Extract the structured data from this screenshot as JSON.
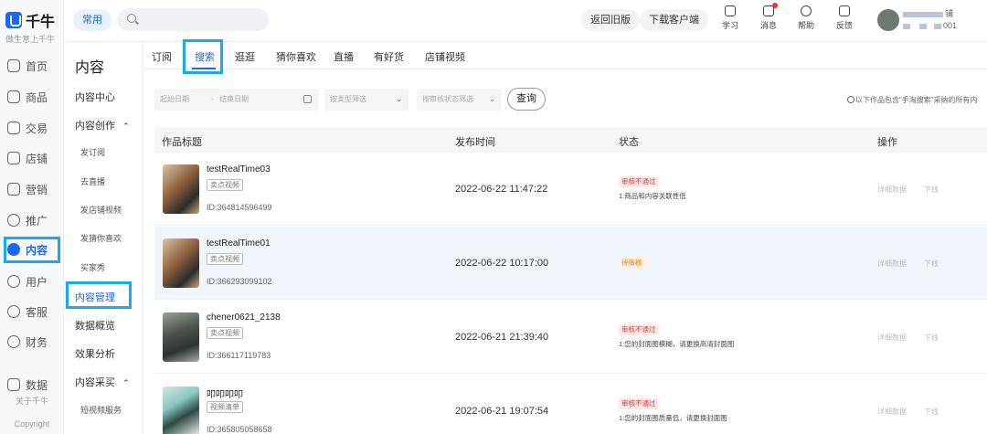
{
  "brand": {
    "name": "千牛",
    "slogan": "做生意上千牛"
  },
  "rail": {
    "items": [
      "首页",
      "商品",
      "交易",
      "店铺",
      "营销",
      "推广",
      "内容",
      "用户",
      "客服",
      "财务",
      "数据"
    ],
    "footer1": "关于千牛",
    "footer2": "Copyright"
  },
  "topbar": {
    "common": "常用",
    "old_version": "返回旧版",
    "download": "下载客户端",
    "tools": [
      "学习",
      "消息",
      "帮助",
      "反馈"
    ],
    "shop_suffix": "铺",
    "account_suffix": "001"
  },
  "nav2": {
    "title": "内容",
    "items": [
      "内容中心",
      "内容创作",
      "发订阅",
      "去直播",
      "发店铺视频",
      "发猜你喜欢",
      "买家秀",
      "内容管理",
      "数据概览",
      "效果分析",
      "内容采买",
      "短视频服务"
    ]
  },
  "tabs": [
    "订阅",
    "搜索",
    "逛逛",
    "猜你喜欢",
    "直播",
    "有好货",
    "店铺视频"
  ],
  "filters": {
    "start_date": "起始日期",
    "dash": "-",
    "end_date": "结束日期",
    "type": "按类型筛选",
    "audit": "按审核状态筛选",
    "query": "查询",
    "tip": "以下作品包含“手淘搜索”采纳的所有内"
  },
  "table": {
    "headers": [
      "作品标题",
      "发布时间",
      "状态",
      "操作"
    ],
    "rows": [
      {
        "title": "testRealTime03",
        "tag": "卖点视频",
        "id": "ID:364814596499",
        "time": "2022-06-22 11:47:22",
        "status": "审核不通过",
        "reason": "1:商品和内容关联性低",
        "detail": "详细数据",
        "offline": "下线"
      },
      {
        "title": "testRealTime01",
        "tag": "卖点视频",
        "id": "ID:366293099102",
        "time": "2022-06-22 10:17:00",
        "status": "待审核",
        "reason": "",
        "detail": "详细数据",
        "offline": "下线"
      },
      {
        "title": "chener0621_2138",
        "tag": "卖点视频",
        "id": "ID:366117119783",
        "time": "2022-06-21 21:39:40",
        "status": "审核不通过",
        "reason": "1:您的封面图模糊，请更换高清封面图",
        "detail": "详细数据",
        "offline": "下线"
      },
      {
        "title": "叩叩叩叩",
        "tag": "视频清单",
        "id": "ID:365805058658",
        "time": "2022-06-21 19:07:54",
        "status": "审核不通过",
        "reason": "1:您的封面图质量低，请更换封面图",
        "detail": "详细数据",
        "offline": "下线"
      }
    ]
  },
  "colors": {
    "accent": "#1a66ff",
    "highlight": "#19a9f0",
    "reject": "#ee3333",
    "pending": "#f07b10"
  }
}
